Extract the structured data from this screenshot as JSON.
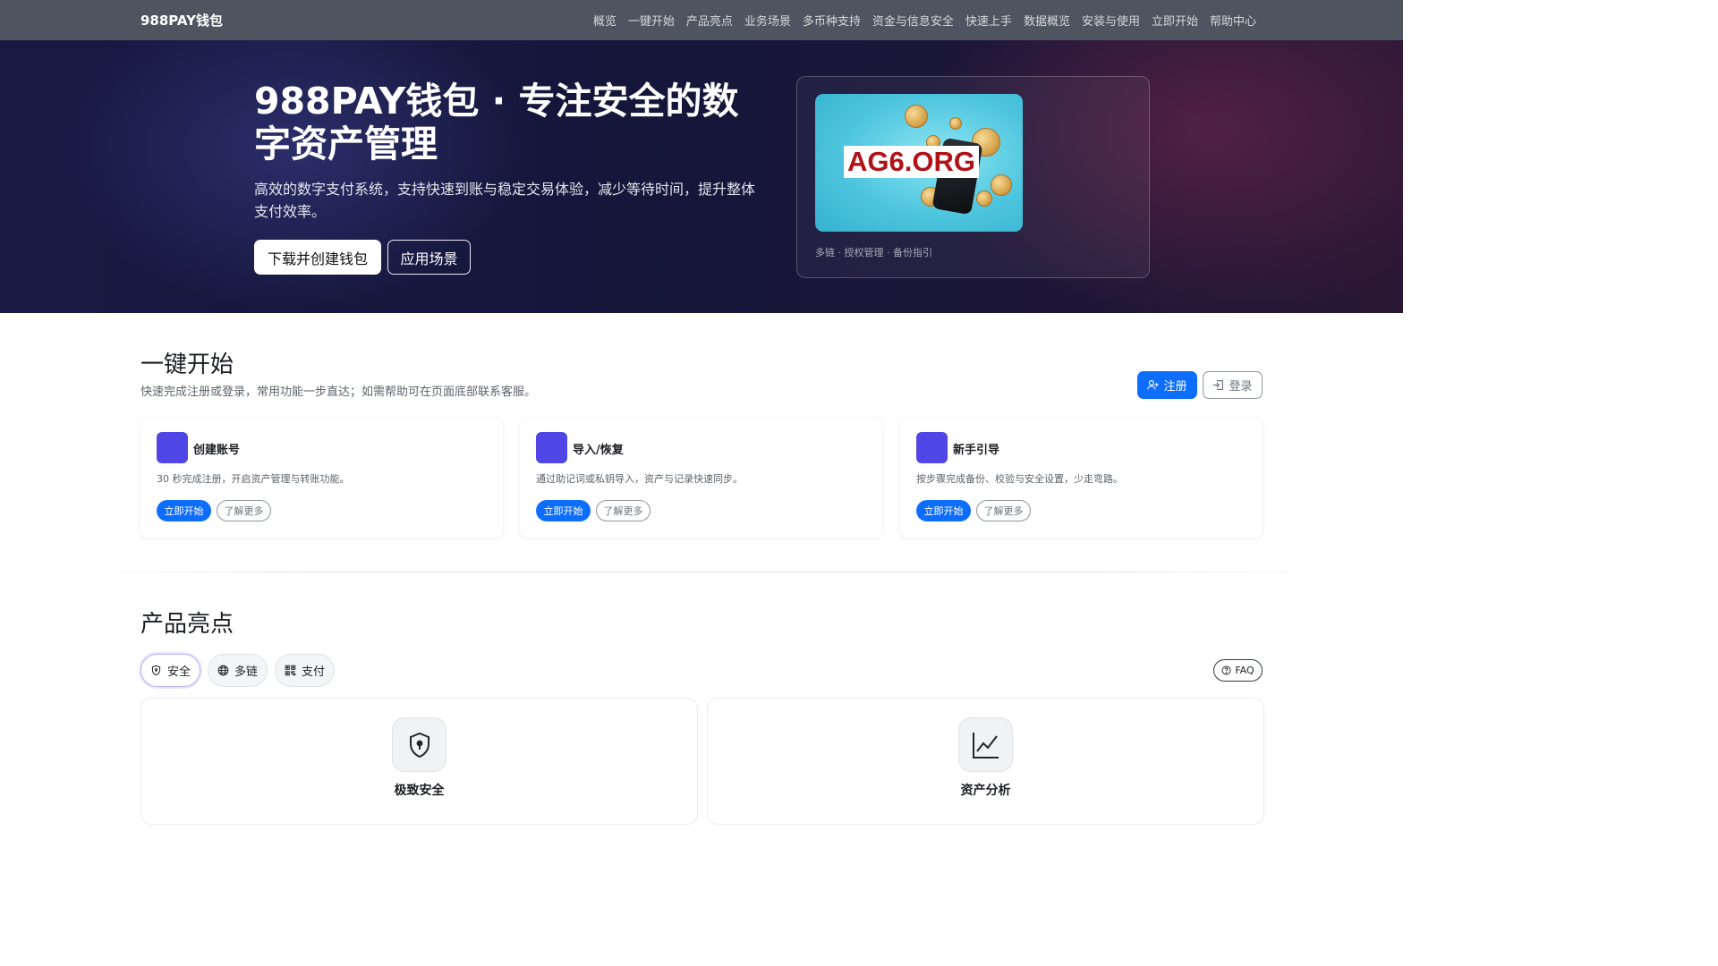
{
  "nav": {
    "brand": "988PAY钱包",
    "links": [
      "概览",
      "一键开始",
      "产品亮点",
      "业务场景",
      "多币种支持",
      "资金与信息安全",
      "快速上手",
      "数据概览",
      "安装与使用",
      "立即开始",
      "帮助中心"
    ]
  },
  "hero": {
    "title": "988PAY钱包 · 专注安全的数字资产管理",
    "subtitle": "高效的数字支付系统，支持快速到账与稳定交易体验，减少等待时间，提升整体支付效率。",
    "primary_button": "下载并创建钱包",
    "secondary_button": "应用场景",
    "image_overlay_text": "AG6.ORG",
    "card_caption": "多链 · 授权管理 · 备份指引"
  },
  "quickstart": {
    "title": "一键开始",
    "subtitle": "快速完成注册或登录，常用功能一步直达；如需帮助可在页面底部联系客服。",
    "register_label": "注册",
    "login_label": "登录",
    "cards": [
      {
        "title": "创建账号",
        "desc": "30 秒完成注册，开启资产管理与转账功能。",
        "primary": "立即开始",
        "secondary": "了解更多"
      },
      {
        "title": "导入/恢复",
        "desc": "通过助记词或私钥导入，资产与记录快速同步。",
        "primary": "立即开始",
        "secondary": "了解更多"
      },
      {
        "title": "新手引导",
        "desc": "按步骤完成备份、校验与安全设置，少走弯路。",
        "primary": "立即开始",
        "secondary": "了解更多"
      }
    ]
  },
  "highlights": {
    "title": "产品亮点",
    "tabs": [
      {
        "label": "安全",
        "icon": "shield-icon",
        "active": true
      },
      {
        "label": "多链",
        "icon": "globe-icon",
        "active": false
      },
      {
        "label": "支付",
        "icon": "qrcode-icon",
        "active": false
      }
    ],
    "faq_label": "FAQ",
    "features": [
      {
        "title": "极致安全",
        "icon": "shield-lock-icon"
      },
      {
        "title": "资产分析",
        "icon": "line-chart-icon"
      }
    ]
  },
  "colors": {
    "nav_bg": "#4e5560",
    "primary": "#0d6efd",
    "card_accent": "#4f46e5",
    "hero_bg": "#181a44"
  }
}
